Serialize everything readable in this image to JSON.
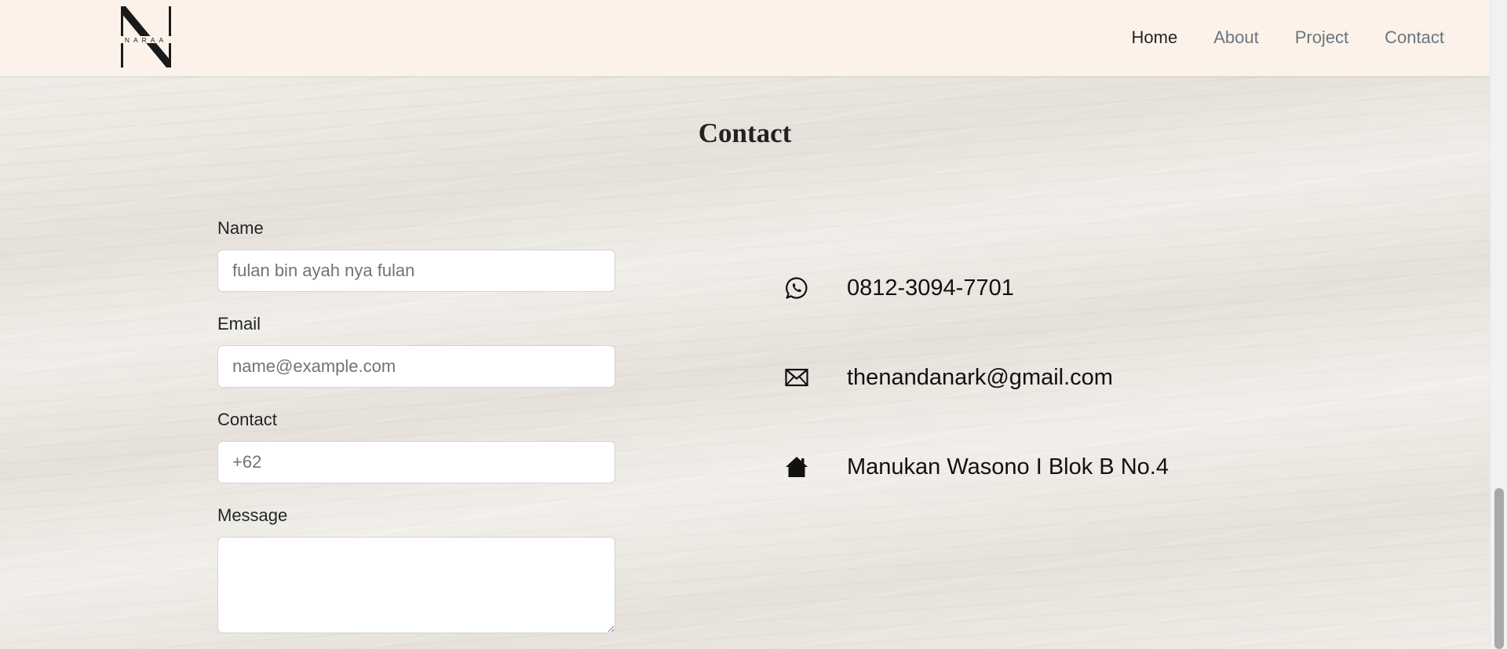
{
  "brand": {
    "logo_text": "NARAA",
    "logo_letter": "N"
  },
  "nav": {
    "items": [
      {
        "label": "Home",
        "active": true
      },
      {
        "label": "About",
        "active": false
      },
      {
        "label": "Project",
        "active": false
      },
      {
        "label": "Contact",
        "active": false
      }
    ]
  },
  "section": {
    "title": "Contact"
  },
  "form": {
    "name": {
      "label": "Name",
      "placeholder": "fulan bin ayah nya fulan",
      "value": ""
    },
    "email": {
      "label": "Email",
      "placeholder": "name@example.com",
      "value": ""
    },
    "contact": {
      "label": "Contact",
      "placeholder": "+62",
      "value": ""
    },
    "message": {
      "label": "Message",
      "placeholder": "",
      "value": ""
    }
  },
  "info": {
    "phone": {
      "icon": "whatsapp-icon",
      "text": "0812-3094-7701"
    },
    "email": {
      "icon": "envelope-icon",
      "text": "thenandanark@gmail.com"
    },
    "address": {
      "icon": "house-icon",
      "text": "Manukan Wasono I Blok B No.4"
    }
  },
  "colors": {
    "navbar_bg": "#fcf2e9",
    "nav_active": "#212529",
    "nav_inactive": "#6c757d"
  }
}
